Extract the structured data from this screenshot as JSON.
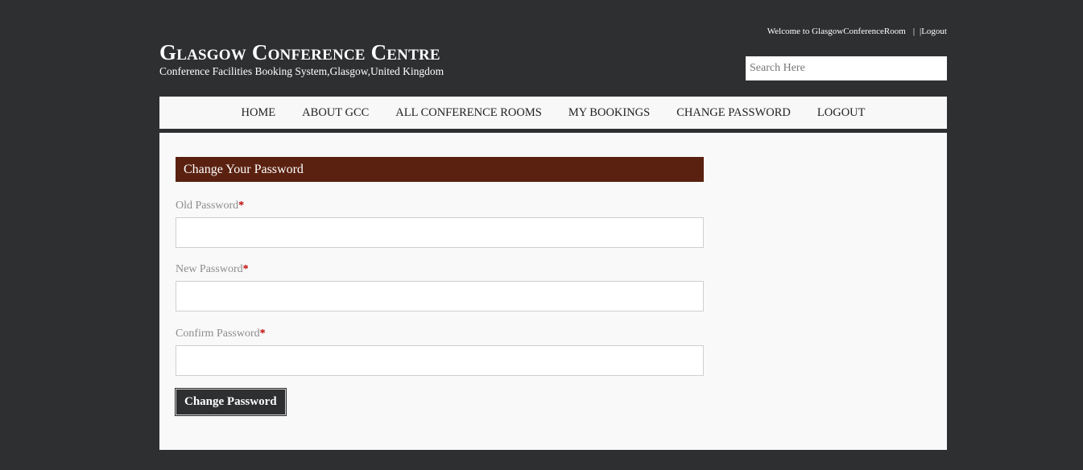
{
  "topbar": {
    "welcome_text": "Welcome to GlasgowConferenceRoom",
    "separator": "|",
    "logout_link": "|Logout"
  },
  "brand": {
    "title": "Glasgow Conference Centre",
    "subtitle": "Conference Facilities Booking System,Glasgow,United Kingdom"
  },
  "search": {
    "placeholder": "Search Here"
  },
  "nav": {
    "items": [
      {
        "label": "HOME"
      },
      {
        "label": "ABOUT GCC"
      },
      {
        "label": "ALL CONFERENCE ROOMS"
      },
      {
        "label": "MY BOOKINGS"
      },
      {
        "label": "CHANGE PASSWORD"
      },
      {
        "label": "LOGOUT"
      }
    ]
  },
  "form": {
    "heading": "Change Your Password",
    "required_marker": "*",
    "fields": [
      {
        "label": "Old Password",
        "value": ""
      },
      {
        "label": "New Password",
        "value": ""
      },
      {
        "label": "Confirm Password",
        "value": ""
      }
    ],
    "submit_label": "Change Password"
  },
  "colors": {
    "page_bg": "#2e2f31",
    "panel_bg": "#f9f9f9",
    "header_accent": "#5a2110",
    "required": "#c00000"
  }
}
